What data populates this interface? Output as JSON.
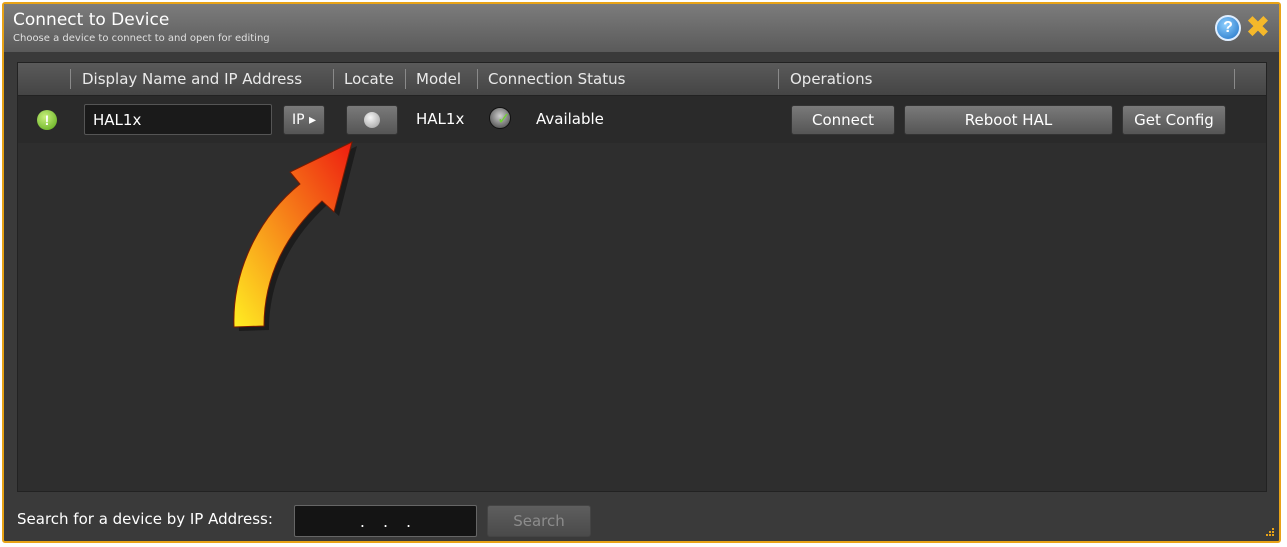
{
  "window": {
    "title": "Connect to Device",
    "subtitle": "Choose a device to connect to and open for editing",
    "help_icon": "?",
    "close_icon": "✖"
  },
  "table": {
    "columns": [
      "Display Name and IP Address",
      "Locate",
      "Model",
      "Connection Status",
      "Operations"
    ],
    "rows": [
      {
        "status_icon": "!",
        "display_name": "HAL1x",
        "ip_button": "IP ▸",
        "model": "HAL1x",
        "connection_status": "Available",
        "operations": {
          "connect": "Connect",
          "reboot": "Reboot HAL",
          "get_config": "Get Config"
        }
      }
    ]
  },
  "footer": {
    "search_label": "Search for a device by IP Address:",
    "ip_value": "...",
    "search_button": "Search"
  },
  "colors": {
    "window_border": "#e8a317",
    "arrow_start": "#ffee22",
    "arrow_end": "#ee1c10"
  }
}
